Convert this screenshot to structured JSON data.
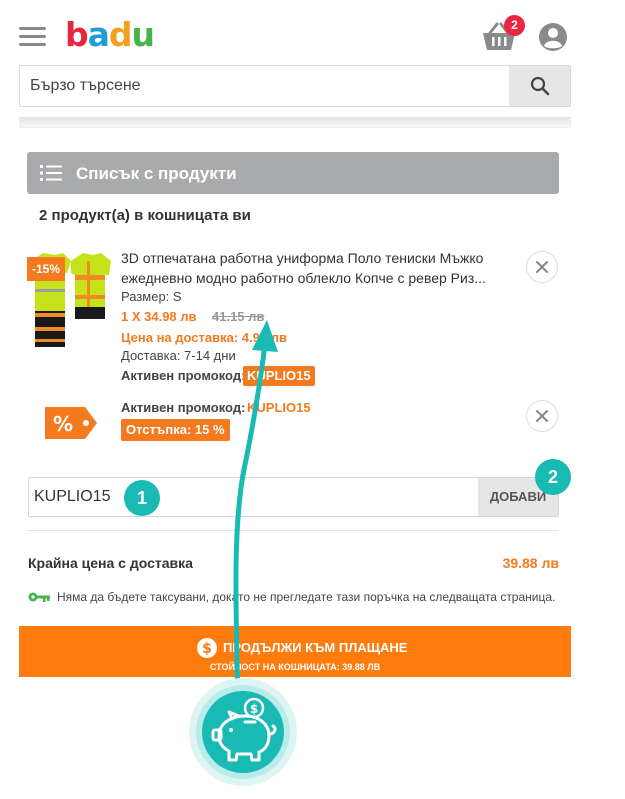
{
  "header": {
    "logo": {
      "text": "badu",
      "colors": [
        "#e8263f",
        "#1ea0d6",
        "#f4a11c",
        "#46b549"
      ]
    },
    "cart_count": "2"
  },
  "search": {
    "placeholder": "Бързо търсене"
  },
  "product_list": {
    "title": "Списък с продукти",
    "count_text": "2 продукт(а) в кошницата ви"
  },
  "product": {
    "discount": "-15%",
    "title": "3D отпечатана работна униформа Поло тениски Мъжко ежедневно модно работно облекло Копче с ревер Риз...",
    "size": "Размер: S",
    "price": "1 X 34.98 лв",
    "old_price": "41.15 лв",
    "shipping_price": "Цена на доставка: 4.90 лв",
    "delivery": "Доставка: 7-14 дни",
    "promo_label": "Активен промокод:",
    "promo_code": "KUPLIO15"
  },
  "promo": {
    "label": "Активен промокод:",
    "code": "KUPLIO15",
    "discount": "Отстъпка: 15 %"
  },
  "coupon": {
    "value": "KUPLIO15",
    "button": "ДОБАВИ"
  },
  "total": {
    "label": "Крайна цена с доставка",
    "value": "39.88 лв"
  },
  "notice": "Няма да бъдете таксувани, докато не прегледате тази поръчка на следващата страница.",
  "checkout": {
    "label": "ПРОДЪЛЖИ КЪМ ПЛАЩАНЕ",
    "subtitle": "СТОЙНОСТ НА КОШНИЦАТА: 39.88 ЛВ"
  },
  "overlay": {
    "step1": "1",
    "step2": "2",
    "accent": "#19b9b4"
  }
}
